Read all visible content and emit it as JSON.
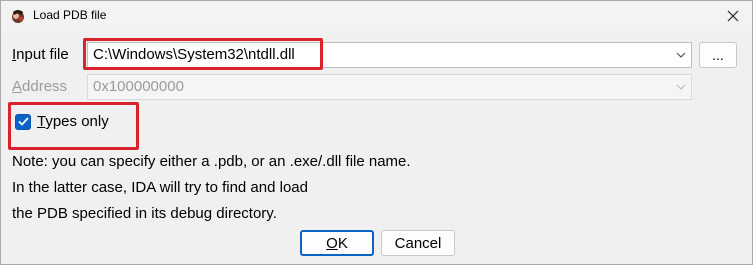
{
  "window": {
    "title": "Load PDB file",
    "icon": "ida-app-icon",
    "close_icon": "close-icon"
  },
  "input_file": {
    "label_accel": "I",
    "label_rest": "nput file",
    "value": "C:\\Windows\\System32\\ntdll.dll",
    "browse_label": "..."
  },
  "address": {
    "label_accel": "A",
    "label_rest": "ddress",
    "value": "0x100000000",
    "enabled": false
  },
  "types_only": {
    "label_accel": "T",
    "label_rest": "ypes only",
    "checked": true
  },
  "note": {
    "line1": "Note: you can specify either a .pdb, or an .exe/.dll file name.",
    "line2": "In the latter case, IDA will try to find and load",
    "line3": "the PDB specified in its debug directory."
  },
  "buttons": {
    "ok_accel": "O",
    "ok_rest": "K",
    "cancel": "Cancel"
  },
  "colors": {
    "highlight": "#d9232d",
    "accent": "#0a63c9"
  }
}
